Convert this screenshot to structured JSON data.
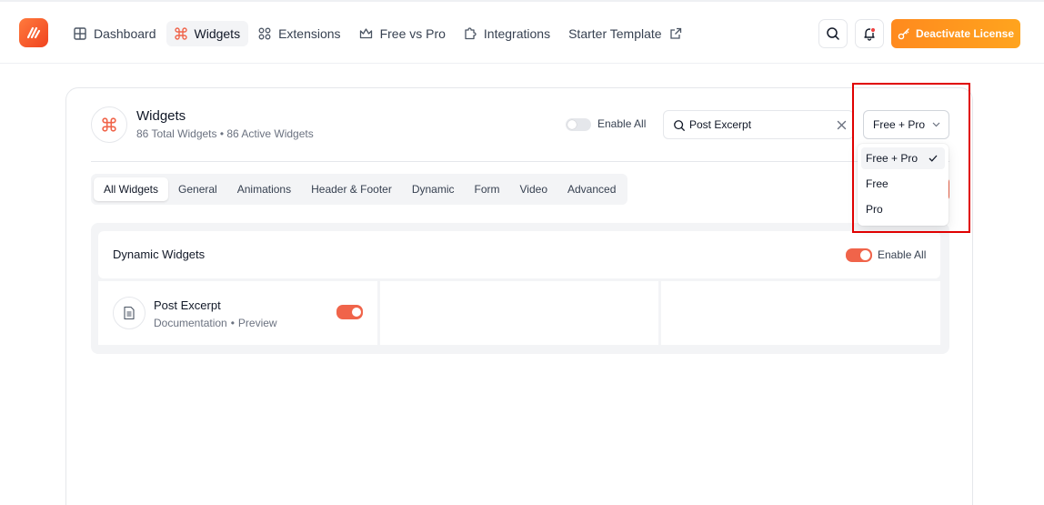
{
  "nav": {
    "items": [
      {
        "label": "Dashboard",
        "icon": "grid-icon"
      },
      {
        "label": "Widgets",
        "icon": "command-icon",
        "active": true
      },
      {
        "label": "Extensions",
        "icon": "extensions-icon"
      },
      {
        "label": "Free vs Pro",
        "icon": "crown-icon"
      },
      {
        "label": "Integrations",
        "icon": "puzzle-icon"
      },
      {
        "label": "Starter Template",
        "icon": "external-link-icon"
      }
    ],
    "deactivate_label": "Deactivate License"
  },
  "colors": {
    "accent": "#f0644a",
    "cta": "#ff9a1e"
  },
  "header": {
    "title": "Widgets",
    "subtitle": "86 Total Widgets • 86 Active Widgets",
    "enable_all_label": "Enable All",
    "search_value": "Post Excerpt",
    "filter_value": "Free + Pro"
  },
  "filter_options": [
    "Free + Pro",
    "Free",
    "Pro"
  ],
  "tabs": [
    "All Widgets",
    "General",
    "Animations",
    "Header & Footer",
    "Dynamic",
    "Form",
    "Video",
    "Advanced"
  ],
  "section": {
    "title": "Dynamic Widgets",
    "enable_all_label": "Enable All"
  },
  "widget": {
    "name": "Post Excerpt",
    "doc_label": "Documentation",
    "separator": "•",
    "preview_label": "Preview"
  }
}
